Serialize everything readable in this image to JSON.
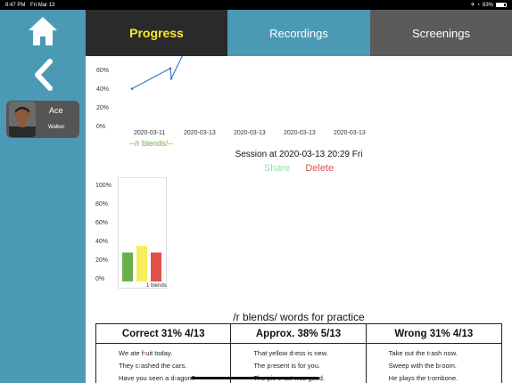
{
  "status": {
    "time": "8:47 PM",
    "date": "Fri Mar 13",
    "battery": "83%"
  },
  "sidebar": {
    "home_icon": "home-icon",
    "back_icon": "chevron-left-icon",
    "profile": {
      "name": "Ace",
      "subtitle": "Walker"
    }
  },
  "tabs": [
    {
      "label": "Progress"
    },
    {
      "label": "Recordings"
    },
    {
      "label": "Screenings"
    }
  ],
  "line_chart_labels": {
    "y_ticks": [
      "60%",
      "40%",
      "20%",
      "0%"
    ],
    "x_ticks": [
      "2020-03-11",
      "2020-03-13",
      "2020-03-13",
      "2020-03-13",
      "2020-03-13"
    ],
    "caption": "--/r blends/--"
  },
  "session": {
    "title": "Session at 2020-03-13 20:29 Fri",
    "share_label": "Share",
    "delete_label": "Delete"
  },
  "chart_data": [
    {
      "type": "line",
      "x": [
        "2020-03-11",
        "2020-03-13",
        "2020-03-13",
        "2020-03-13",
        "2020-03-13"
      ],
      "series": [
        {
          "values": [
            38,
            58,
            48,
            82
          ]
        }
      ],
      "ylim": [
        0,
        70
      ],
      "color": "#3a7ec6"
    },
    {
      "type": "bar",
      "categories": [
        "1 blends"
      ],
      "series": [
        {
          "values": [
            31
          ],
          "color": "#6ab04c"
        },
        {
          "values": [
            38
          ],
          "color": "#f7ec5a"
        },
        {
          "values": [
            31
          ],
          "color": "#e0524a"
        }
      ],
      "ylim": [
        0,
        100
      ],
      "y_ticks": [
        "100%",
        "80%",
        "60%",
        "40%",
        "20%",
        "0%"
      ]
    }
  ],
  "practice": {
    "title": "/r blends/ words for practice",
    "columns": [
      {
        "header": "Correct 31% 4/13",
        "rows": [
          [
            "We ate f",
            "r",
            "uit today."
          ],
          [
            "They c",
            "r",
            "ashed the cars."
          ],
          [
            "Have you seen a d",
            "r",
            "agon?"
          ]
        ]
      },
      {
        "header": "Approx. 38% 5/13",
        "rows": [
          [
            "That yellow d",
            "r",
            "ess is new."
          ],
          [
            "The p",
            "r",
            "esent is for you."
          ],
          [
            "The pie c",
            "r",
            "ust was good."
          ]
        ]
      },
      {
        "header": "Wrong 31% 4/13",
        "rows": [
          [
            "Take out the t",
            "r",
            "ash now."
          ],
          [
            "Sweep with the b",
            "r",
            "oom."
          ],
          [
            "He plays the t",
            "r",
            "ombone."
          ]
        ]
      }
    ]
  }
}
